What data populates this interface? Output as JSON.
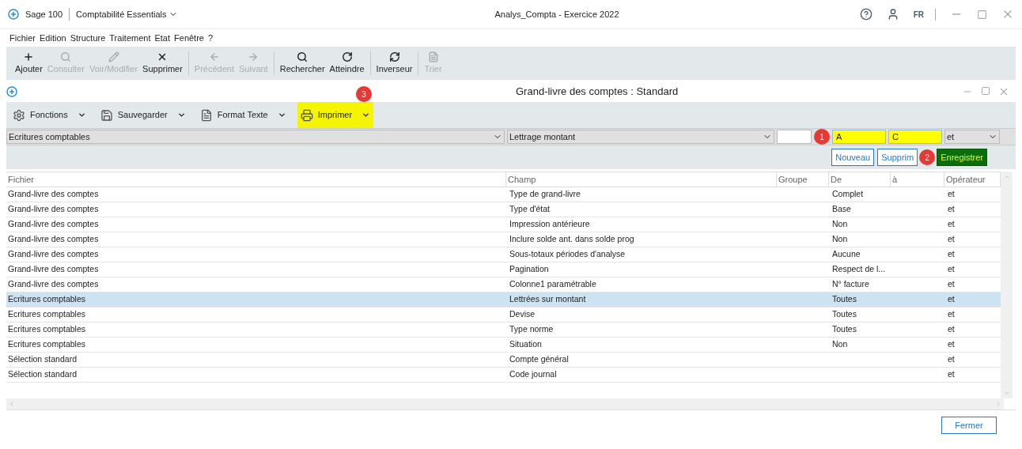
{
  "app": {
    "product": "Sage 100",
    "module": "Comptabilité Essentials",
    "title": "Analys_Compta - Exercice 2022",
    "language": "FR"
  },
  "menu": [
    "Fichier",
    "Edition",
    "Structure",
    "Traitement",
    "Etat",
    "Fenêtre",
    "?"
  ],
  "toolbar_groups": [
    {
      "buttons": [
        {
          "label": "Ajouter",
          "disabled": false
        },
        {
          "label": "Consulter",
          "disabled": true
        },
        {
          "label": "Voir/Modifier",
          "disabled": true
        },
        {
          "label": "Supprimer",
          "disabled": false
        }
      ]
    },
    {
      "buttons": [
        {
          "label": "Précédent",
          "disabled": true
        },
        {
          "label": "Suivant",
          "disabled": true
        }
      ]
    },
    {
      "buttons": [
        {
          "label": "Rechercher",
          "disabled": false
        },
        {
          "label": "Atteindre",
          "disabled": false
        }
      ]
    },
    {
      "buttons": [
        {
          "label": "Inverseur",
          "disabled": false
        }
      ]
    },
    {
      "buttons": [
        {
          "label": "Trier",
          "disabled": true
        }
      ]
    }
  ],
  "window": {
    "title": "Grand-livre des comptes : Standard"
  },
  "functions": [
    {
      "label": "Fonctions",
      "highlighted": false
    },
    {
      "label": "Sauvegarder",
      "highlighted": false
    },
    {
      "label": "Format Texte",
      "highlighted": false
    },
    {
      "label": "Imprimer",
      "highlighted": true,
      "badge": "3"
    }
  ],
  "filter": {
    "file": "Ecritures comptables",
    "field": "Lettrage montant",
    "from": {
      "value": "A",
      "highlighted": true,
      "badge": "1"
    },
    "to": {
      "value": "C",
      "highlighted": true
    },
    "operator": "et"
  },
  "actions": [
    {
      "label": "Nouveau",
      "kind": "outline"
    },
    {
      "label": "Supprim",
      "kind": "outline"
    },
    {
      "label": "Enregistrer",
      "kind": "primary",
      "badge": "2"
    }
  ],
  "table": {
    "columns": [
      "Fichier",
      "Champ",
      "Groupe",
      "De",
      "à",
      "Opérateur"
    ],
    "rows": [
      {
        "cells": [
          "Grand-livre des comptes",
          "Type de grand-livre",
          "",
          "Complet",
          "",
          "et"
        ],
        "selected": false
      },
      {
        "cells": [
          "Grand-livre des comptes",
          "Type d'état",
          "",
          "Base",
          "",
          "et"
        ],
        "selected": false
      },
      {
        "cells": [
          "Grand-livre des comptes",
          "Impression antérieure",
          "",
          "Non",
          "",
          "et"
        ],
        "selected": false
      },
      {
        "cells": [
          "Grand-livre des comptes",
          "Inclure solde ant. dans solde prog",
          "",
          "Non",
          "",
          "et"
        ],
        "selected": false
      },
      {
        "cells": [
          "Grand-livre des comptes",
          "Sous-totaux périodes d'analyse",
          "",
          "Aucune",
          "",
          "et"
        ],
        "selected": false
      },
      {
        "cells": [
          "Grand-livre des comptes",
          "Pagination",
          "",
          "Respect de l...",
          "",
          "et"
        ],
        "selected": false
      },
      {
        "cells": [
          "Grand-livre des comptes",
          "Colonne1 paramétrable",
          "",
          "N° facture",
          "",
          "et"
        ],
        "selected": false
      },
      {
        "cells": [
          "Ecritures comptables",
          "Lettrées sur montant",
          "",
          "Toutes",
          "",
          "et"
        ],
        "selected": true
      },
      {
        "cells": [
          "Ecritures comptables",
          "Devise",
          "",
          "Toutes",
          "",
          "et"
        ],
        "selected": false
      },
      {
        "cells": [
          "Ecritures comptables",
          "Type norme",
          "",
          "Toutes",
          "",
          "et"
        ],
        "selected": false
      },
      {
        "cells": [
          "Ecritures comptables",
          "Situation",
          "",
          "Non",
          "",
          "et"
        ],
        "selected": false
      },
      {
        "cells": [
          "Sélection standard",
          "Compte général",
          "",
          "",
          "",
          "et"
        ],
        "selected": false
      },
      {
        "cells": [
          "Sélection standard",
          "Code journal",
          "",
          "",
          "",
          "et"
        ],
        "selected": false
      }
    ]
  },
  "footer": {
    "close": "Fermer"
  }
}
